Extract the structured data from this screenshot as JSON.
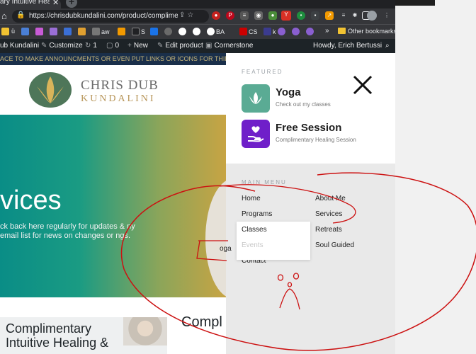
{
  "browser": {
    "tab_title": "ary Intuitive Healing",
    "url": "https://chrisdubkundalini.com/product/complimen…",
    "bookmarks": [
      "ü",
      "aw",
      "S",
      "BA",
      "CS",
      "k"
    ],
    "other_bookmarks": "Other bookmarks"
  },
  "admin_bar": {
    "site": "ub Kundalini",
    "customize": "Customize",
    "updates": "1",
    "comments": "0",
    "new": "New",
    "edit": "Edit product",
    "cornerstone": "Cornerstone",
    "howdy": "Howdy, Erich Bertussi"
  },
  "site": {
    "announcement": "ACE TO MAKE ANNOUNCMENTS OR EVEN PUT LINKS OR ICONS FOR THINGS",
    "logo_line1": "CHRIS DUB",
    "logo_line2": "KUNDALINI",
    "hero_title": "vices",
    "hero_text": "ck back here regularly for updates & ny email list for news on changes or ngs.",
    "card1_title": "Complimentary Intuitive Healing &",
    "card2_title": "Compl Heali"
  },
  "menu": {
    "featured_label": "FEATURED",
    "featured": [
      {
        "title": "Yoga",
        "subtitle": "Check out my classes",
        "color": "#5aab94",
        "icon": "lotus-icon"
      },
      {
        "title": "Free Session",
        "subtitle": "Complimentary Healing Session",
        "color": "#6f1fc9",
        "icon": "heart-hand-icon"
      }
    ],
    "main_label": "MAIN MENU",
    "col1": [
      "Home",
      "Programs",
      "Classes",
      "Events",
      "Contact"
    ],
    "col2": [
      "About Me",
      "Services",
      "Retreats",
      "Soul Guided"
    ],
    "ghost": "oga"
  },
  "colors": {
    "admin_bar": "#1d2327",
    "annotation": "#cc1111"
  }
}
